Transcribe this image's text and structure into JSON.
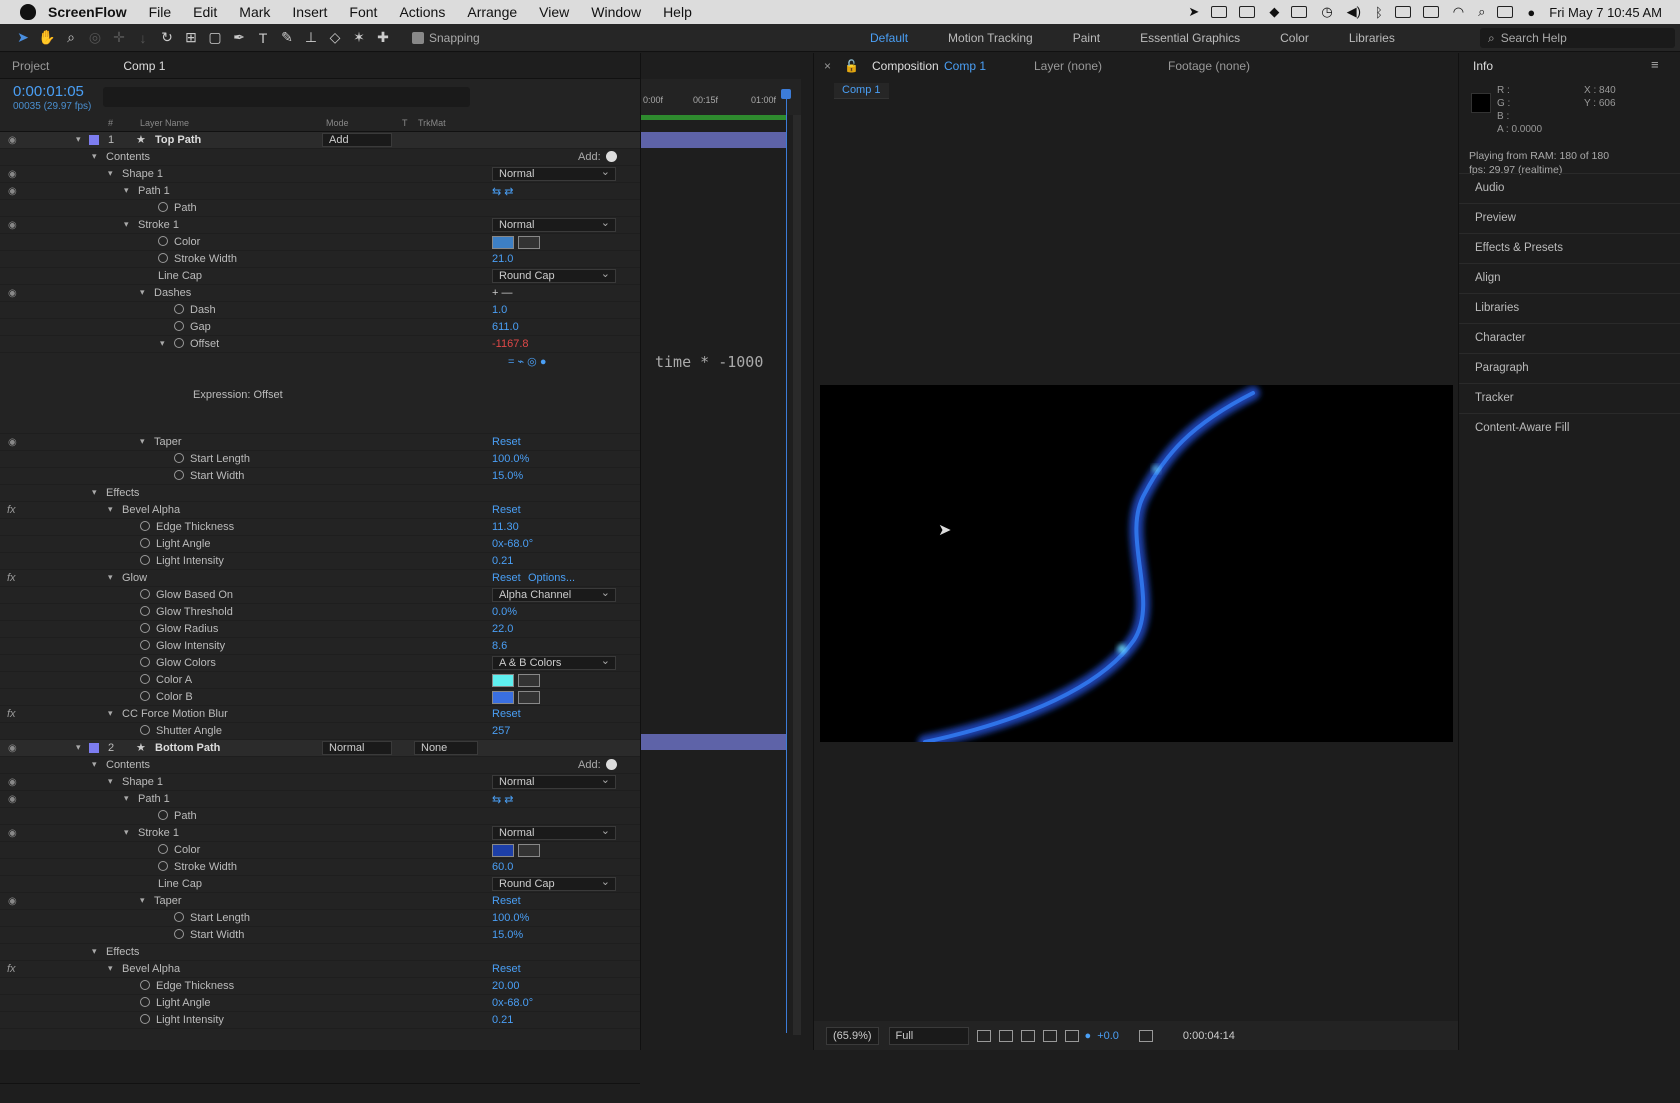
{
  "menubar": {
    "app": "ScreenFlow",
    "items": [
      "File",
      "Edit",
      "Mark",
      "Insert",
      "Font",
      "Actions",
      "Arrange",
      "View",
      "Window",
      "Help"
    ],
    "datetime": "Fri May 7  10:45 AM"
  },
  "toolbar": {
    "snapping": "Snapping",
    "workspaces": [
      "Default",
      "Motion Tracking",
      "Paint",
      "Essential Graphics",
      "Color",
      "Libraries"
    ],
    "search_placeholder": "Search Help"
  },
  "panel_tabs": {
    "project": "Project",
    "comp": "Comp 1"
  },
  "timecode": {
    "main": "0:00:01:05",
    "sub": "00035 (29.97 fps)"
  },
  "columns": {
    "num": "#",
    "layer_name": "Layer Name",
    "mode": "Mode",
    "t": "T",
    "trkmat": "TrkMat"
  },
  "ruler": {
    "t0": "0:00f",
    "t1": "00:15f",
    "t2": "01:00f"
  },
  "expression_text": "time * -1000",
  "layer1": {
    "num": "1",
    "name": "Top Path",
    "mode": "Add",
    "contents": "Contents",
    "add": "Add:",
    "shape": "Shape 1",
    "shape_mode": "Normal",
    "path1": "Path 1",
    "path": "Path",
    "stroke": "Stroke 1",
    "stroke_mode": "Normal",
    "color": "Color",
    "stroke_width_lbl": "Stroke Width",
    "stroke_width": "21.0",
    "linecap_lbl": "Line Cap",
    "linecap": "Round Cap",
    "dashes": "Dashes",
    "dash_lbl": "Dash",
    "dash": "1.0",
    "gap_lbl": "Gap",
    "gap": "611.0",
    "offset_lbl": "Offset",
    "offset": "-1167.8",
    "expression_lbl": "Expression: Offset",
    "taper": "Taper",
    "reset": "Reset",
    "start_length_lbl": "Start Length",
    "start_length": "100.0%",
    "start_width_lbl": "Start Width",
    "start_width": "15.0%",
    "effects": "Effects",
    "bevel": "Bevel Alpha",
    "edge_lbl": "Edge Thickness",
    "edge": "11.30",
    "light_angle_lbl": "Light Angle",
    "light_angle": "0x-68.0°",
    "light_int_lbl": "Light Intensity",
    "light_int": "0.21",
    "glow": "Glow",
    "options": "Options...",
    "glow_based_lbl": "Glow Based On",
    "glow_based": "Alpha Channel",
    "glow_thr_lbl": "Glow Threshold",
    "glow_thr": "0.0%",
    "glow_rad_lbl": "Glow Radius",
    "glow_rad": "22.0",
    "glow_int_lbl": "Glow Intensity",
    "glow_int": "8.6",
    "glow_colors_lbl": "Glow Colors",
    "glow_colors": "A & B Colors",
    "color_a": "Color A",
    "color_b": "Color B",
    "mblur": "CC Force Motion Blur",
    "shutter_lbl": "Shutter Angle",
    "shutter": "257"
  },
  "layer2": {
    "num": "2",
    "name": "Bottom Path",
    "mode": "Normal",
    "trkmat": "None",
    "stroke_width": "60.0",
    "edge": "20.00",
    "light_angle": "0x-68.0°",
    "light_int": "0.21"
  },
  "colors": {
    "stroke1": "#3d7fc4",
    "stroke2": "#1d3fa8",
    "glow_a": "#5ff0f0",
    "glow_b": "#3a6fe0",
    "accent": "#4a9ff5"
  },
  "comp": {
    "tab": "Composition",
    "tab_name": "Comp 1",
    "layer_tab": "Layer (none)",
    "footage_tab": "Footage (none)",
    "sub": "Comp 1",
    "zoom": "(65.9%)",
    "res": "Full",
    "exposure": "+0.0",
    "timecode": "0:00:04:14"
  },
  "info": {
    "title": "Info",
    "r": "R :",
    "g": "G :",
    "b": "B :",
    "a": "A :  0.0000",
    "x": "X :  840",
    "y": "Y :  606",
    "playing": "Playing from RAM: 180 of 180",
    "fps": "fps: 29.97 (realtime)",
    "sections": [
      "Audio",
      "Preview",
      "Effects & Presets",
      "Align",
      "Libraries",
      "Character",
      "Paragraph",
      "Tracker",
      "Content-Aware Fill"
    ]
  }
}
